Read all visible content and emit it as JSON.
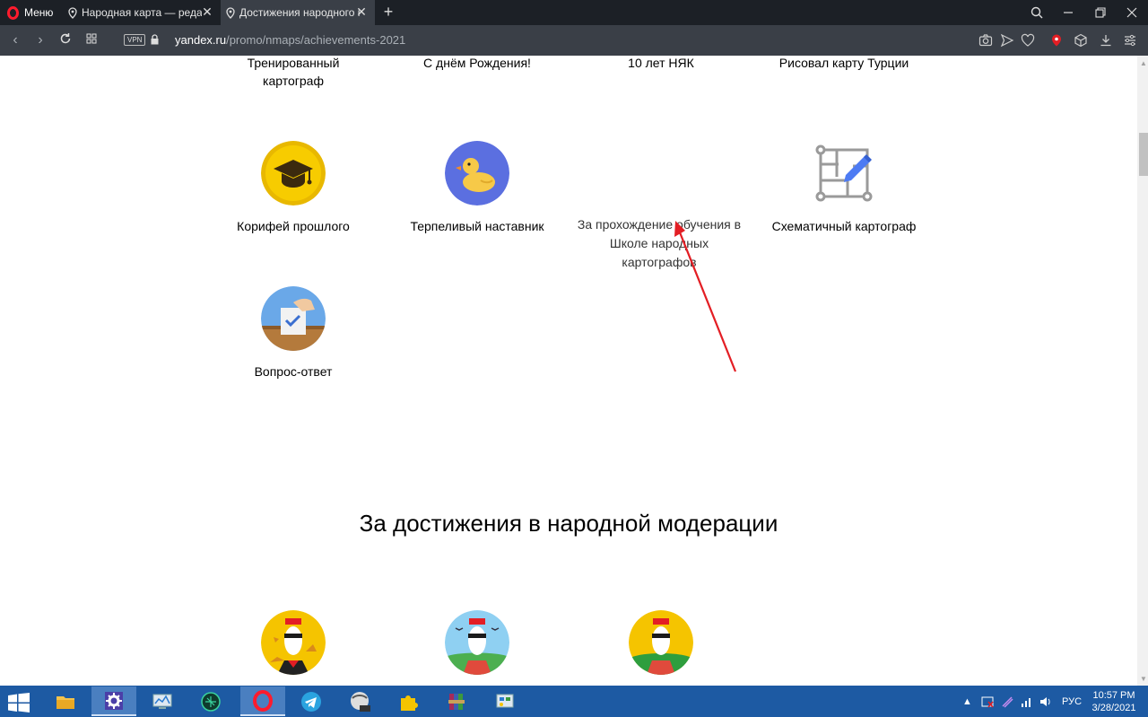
{
  "browser": {
    "menu_label": "Меню",
    "tabs": [
      {
        "title": "Народная карта — редакт"
      },
      {
        "title": "Достижения народного ка"
      }
    ],
    "url_host": "yandex.ru",
    "url_path": "/promo/nmaps/achievements-2021",
    "vpn_label": "VPN"
  },
  "page": {
    "top_row": [
      {
        "label": "Тренированный картограф"
      },
      {
        "label": "С днём Рождения!"
      },
      {
        "label": "10 лет НЯК"
      },
      {
        "label": "Рисовал карту Турции"
      }
    ],
    "middle_row": [
      {
        "label": "Корифей прошлого",
        "icon": "graduation-cap-icon"
      },
      {
        "label": "Терпеливый наставник",
        "icon": "duck-icon"
      },
      {
        "label": "Схематичный картограф",
        "icon": "schematic-pencil-icon"
      }
    ],
    "tooltip": "За прохождение обучения в Школе народных картографов",
    "bottom_row": [
      {
        "label": "Вопрос-ответ",
        "icon": "ballot-box-icon"
      }
    ],
    "section_heading": "За достижения в народной модерации",
    "moderation_badges": [
      {
        "icon": "moderator-autumn-icon"
      },
      {
        "icon": "moderator-sky-icon"
      },
      {
        "icon": "moderator-yellow-icon"
      }
    ]
  },
  "taskbar": {
    "language": "РУС",
    "time": "10:57 PM",
    "date": "3/28/2021"
  },
  "colors": {
    "accent_red": "#e31e24",
    "taskbar_blue": "#1d5aa3",
    "badge_yellow": "#f5c400",
    "badge_blue": "#5b6fe0"
  }
}
